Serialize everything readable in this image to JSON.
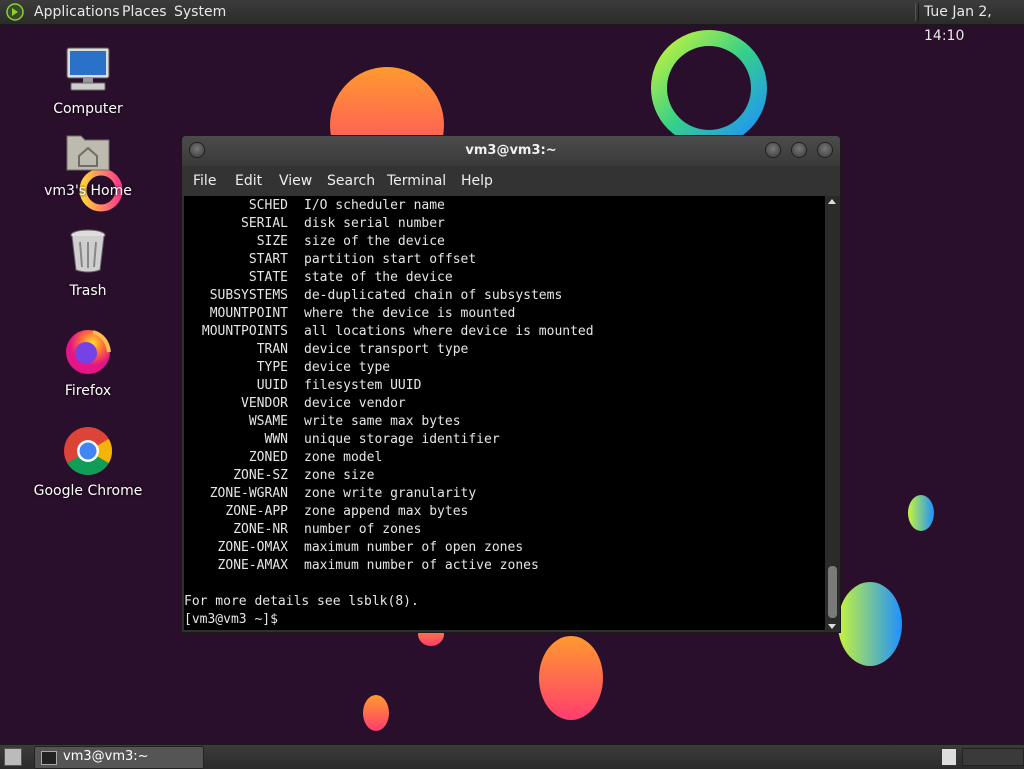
{
  "top_panel": {
    "menus": [
      "Applications",
      "Places",
      "System"
    ],
    "clock": "Tue Jan  2, 14:10"
  },
  "desktop": {
    "icons": [
      {
        "label": "Computer",
        "icon": "computer-icon"
      },
      {
        "label": "vm3's Home",
        "icon": "home-folder-icon"
      },
      {
        "label": "Trash",
        "icon": "trash-icon"
      },
      {
        "label": "Firefox",
        "icon": "firefox-icon"
      },
      {
        "label": "Google Chrome",
        "icon": "chrome-icon"
      }
    ]
  },
  "terminal": {
    "title": "vm3@vm3:~",
    "menu": [
      "File",
      "Edit",
      "View",
      "Search",
      "Terminal",
      "Help"
    ],
    "columns": [
      {
        "name": "SCHED",
        "desc": "I/O scheduler name"
      },
      {
        "name": "SERIAL",
        "desc": "disk serial number"
      },
      {
        "name": "SIZE",
        "desc": "size of the device"
      },
      {
        "name": "START",
        "desc": "partition start offset"
      },
      {
        "name": "STATE",
        "desc": "state of the device"
      },
      {
        "name": "SUBSYSTEMS",
        "desc": "de-duplicated chain of subsystems"
      },
      {
        "name": "MOUNTPOINT",
        "desc": "where the device is mounted"
      },
      {
        "name": "MOUNTPOINTS",
        "desc": "all locations where device is mounted"
      },
      {
        "name": "TRAN",
        "desc": "device transport type"
      },
      {
        "name": "TYPE",
        "desc": "device type"
      },
      {
        "name": "UUID",
        "desc": "filesystem UUID"
      },
      {
        "name": "VENDOR",
        "desc": "device vendor"
      },
      {
        "name": "WSAME",
        "desc": "write same max bytes"
      },
      {
        "name": "WWN",
        "desc": "unique storage identifier"
      },
      {
        "name": "ZONED",
        "desc": "zone model"
      },
      {
        "name": "ZONE-SZ",
        "desc": "zone size"
      },
      {
        "name": "ZONE-WGRAN",
        "desc": "zone write granularity"
      },
      {
        "name": "ZONE-APP",
        "desc": "zone append max bytes"
      },
      {
        "name": "ZONE-NR",
        "desc": "number of zones"
      },
      {
        "name": "ZONE-OMAX",
        "desc": "maximum number of open zones"
      },
      {
        "name": "ZONE-AMAX",
        "desc": "maximum number of active zones"
      }
    ],
    "footer": "For more details see lsblk(8).",
    "prompt": "[vm3@vm3 ~]$"
  },
  "bottom_panel": {
    "task_label": "vm3@vm3:~"
  }
}
